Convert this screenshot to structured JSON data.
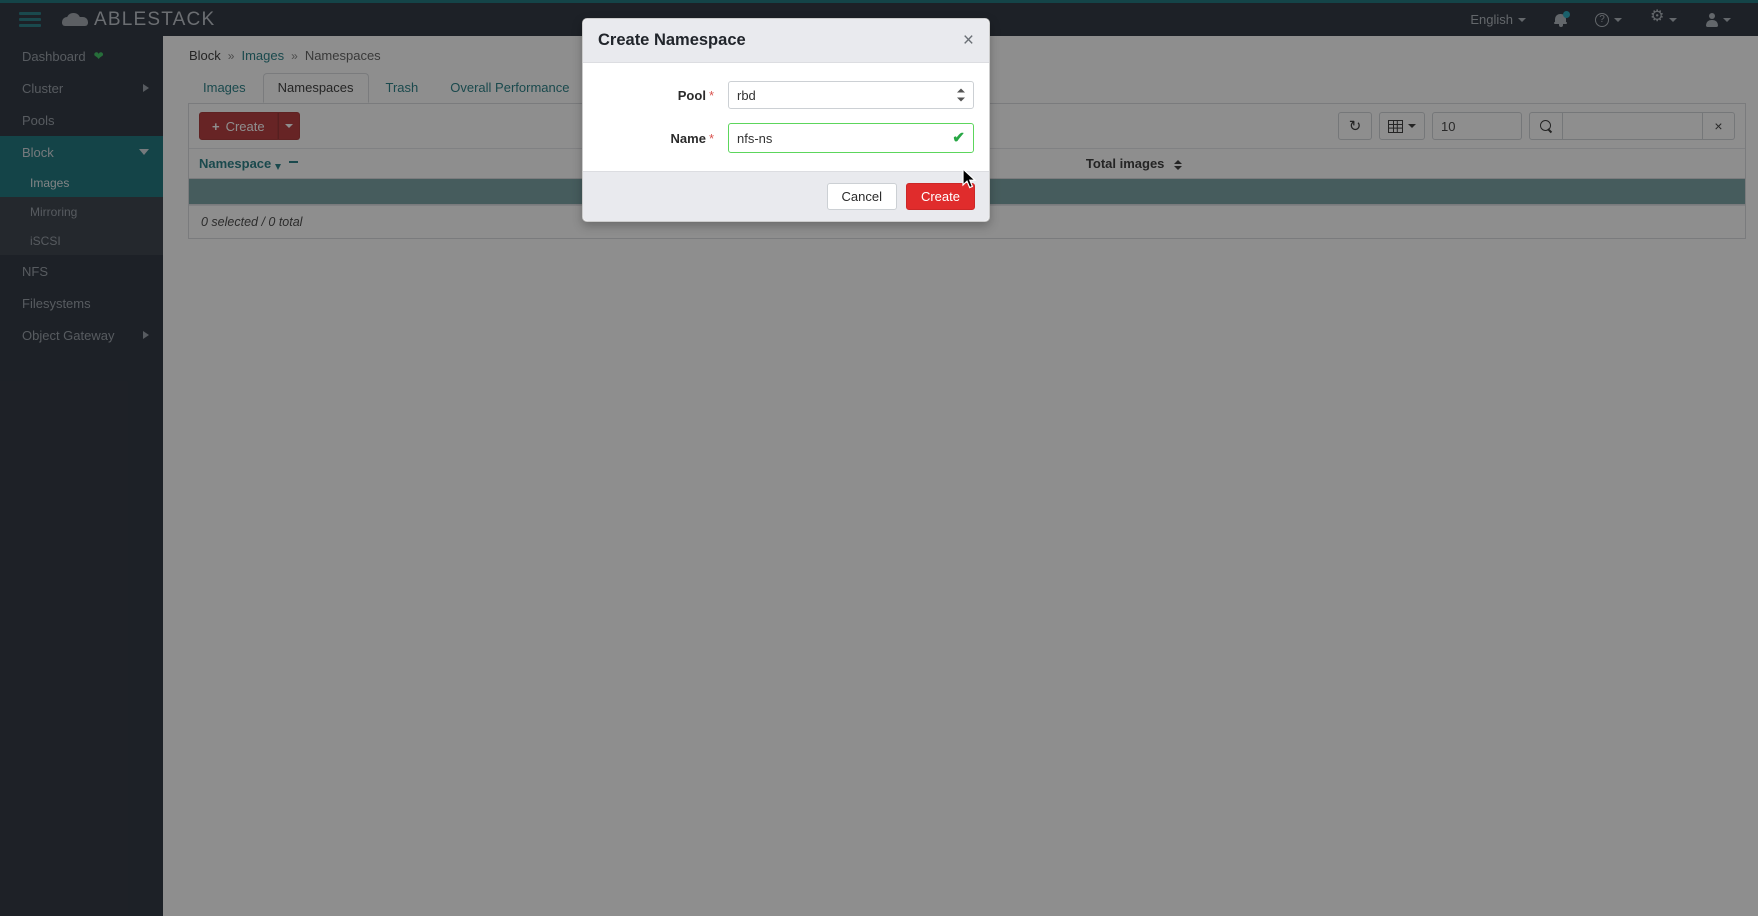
{
  "topbar": {
    "brand": "ABLESTACK",
    "menu_icon": "hamburger-icon",
    "language": "English",
    "notifications_icon": "bell-icon",
    "help_icon": "question-circle-icon",
    "settings_icon": "gear-icon",
    "user_icon": "user-icon",
    "accent_color": "#0b6b72",
    "background_color": "#1d2530"
  },
  "sidebar": {
    "items": [
      {
        "label": "Dashboard",
        "badge": "heart-icon",
        "state": "normal"
      },
      {
        "label": "Cluster",
        "chevron": "chevron-right",
        "state": "normal"
      },
      {
        "label": "Pools",
        "state": "normal"
      },
      {
        "label": "Block",
        "chevron": "chevron-down",
        "state": "active-parent"
      },
      {
        "label": "Images",
        "state": "active-sub"
      },
      {
        "label": "Mirroring",
        "state": "sub"
      },
      {
        "label": "iSCSI",
        "state": "sub"
      },
      {
        "label": "NFS",
        "state": "normal"
      },
      {
        "label": "Filesystems",
        "state": "normal"
      },
      {
        "label": "Object Gateway",
        "chevron": "chevron-right",
        "state": "normal"
      }
    ]
  },
  "breadcrumb": {
    "root": "Block",
    "separator": "»",
    "middle": "Images",
    "current": "Namespaces"
  },
  "tabs": [
    {
      "label": "Images",
      "active": false
    },
    {
      "label": "Namespaces",
      "active": true
    },
    {
      "label": "Trash",
      "active": false
    },
    {
      "label": "Overall Performance",
      "active": false
    }
  ],
  "toolbar": {
    "create_label": "Create",
    "create_plus": "+",
    "create_caret": "caret-down-icon",
    "refresh_icon": "refresh-icon",
    "columns_icon": "table-columns-icon",
    "page_size_value": "10",
    "search_icon": "search-icon",
    "search_value": "",
    "search_clear": "×"
  },
  "table": {
    "columns": [
      {
        "label": "Namespace",
        "sort": "ascending"
      },
      {
        "label": "Total images",
        "sort": "none"
      }
    ],
    "rows": [],
    "footer": "0 selected / 0 total"
  },
  "modal": {
    "title": "Create Namespace",
    "close_icon": "close-icon",
    "fields": {
      "pool": {
        "label": "Pool",
        "required": "*",
        "value": "rbd",
        "options": [
          "rbd"
        ]
      },
      "name": {
        "label": "Name",
        "required": "*",
        "value": "nfs-ns",
        "valid_icon": "✔"
      }
    },
    "cancel_label": "Cancel",
    "submit_label": "Create",
    "submit_color": "#e02c2c"
  }
}
